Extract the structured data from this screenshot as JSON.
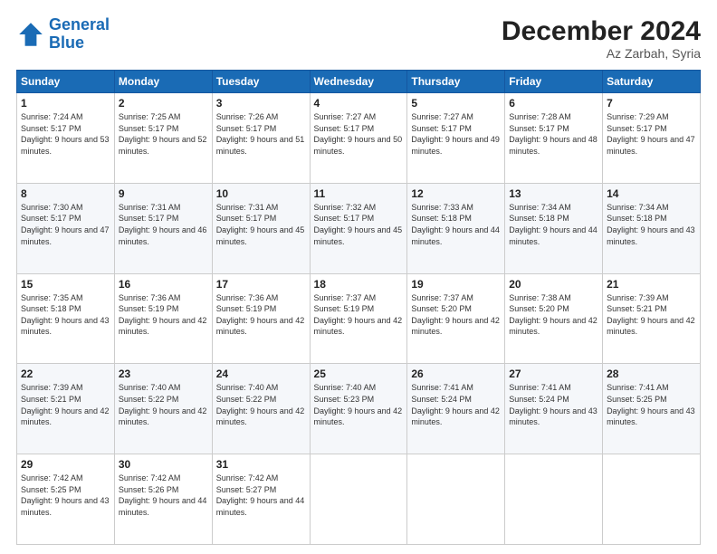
{
  "logo": {
    "line1": "General",
    "line2": "Blue"
  },
  "title": "December 2024",
  "subtitle": "Az Zarbah, Syria",
  "days_header": [
    "Sunday",
    "Monday",
    "Tuesday",
    "Wednesday",
    "Thursday",
    "Friday",
    "Saturday"
  ],
  "weeks": [
    [
      {
        "day": "1",
        "sunrise": "Sunrise: 7:24 AM",
        "sunset": "Sunset: 5:17 PM",
        "daylight": "Daylight: 9 hours and 53 minutes."
      },
      {
        "day": "2",
        "sunrise": "Sunrise: 7:25 AM",
        "sunset": "Sunset: 5:17 PM",
        "daylight": "Daylight: 9 hours and 52 minutes."
      },
      {
        "day": "3",
        "sunrise": "Sunrise: 7:26 AM",
        "sunset": "Sunset: 5:17 PM",
        "daylight": "Daylight: 9 hours and 51 minutes."
      },
      {
        "day": "4",
        "sunrise": "Sunrise: 7:27 AM",
        "sunset": "Sunset: 5:17 PM",
        "daylight": "Daylight: 9 hours and 50 minutes."
      },
      {
        "day": "5",
        "sunrise": "Sunrise: 7:27 AM",
        "sunset": "Sunset: 5:17 PM",
        "daylight": "Daylight: 9 hours and 49 minutes."
      },
      {
        "day": "6",
        "sunrise": "Sunrise: 7:28 AM",
        "sunset": "Sunset: 5:17 PM",
        "daylight": "Daylight: 9 hours and 48 minutes."
      },
      {
        "day": "7",
        "sunrise": "Sunrise: 7:29 AM",
        "sunset": "Sunset: 5:17 PM",
        "daylight": "Daylight: 9 hours and 47 minutes."
      }
    ],
    [
      {
        "day": "8",
        "sunrise": "Sunrise: 7:30 AM",
        "sunset": "Sunset: 5:17 PM",
        "daylight": "Daylight: 9 hours and 47 minutes."
      },
      {
        "day": "9",
        "sunrise": "Sunrise: 7:31 AM",
        "sunset": "Sunset: 5:17 PM",
        "daylight": "Daylight: 9 hours and 46 minutes."
      },
      {
        "day": "10",
        "sunrise": "Sunrise: 7:31 AM",
        "sunset": "Sunset: 5:17 PM",
        "daylight": "Daylight: 9 hours and 45 minutes."
      },
      {
        "day": "11",
        "sunrise": "Sunrise: 7:32 AM",
        "sunset": "Sunset: 5:17 PM",
        "daylight": "Daylight: 9 hours and 45 minutes."
      },
      {
        "day": "12",
        "sunrise": "Sunrise: 7:33 AM",
        "sunset": "Sunset: 5:18 PM",
        "daylight": "Daylight: 9 hours and 44 minutes."
      },
      {
        "day": "13",
        "sunrise": "Sunrise: 7:34 AM",
        "sunset": "Sunset: 5:18 PM",
        "daylight": "Daylight: 9 hours and 44 minutes."
      },
      {
        "day": "14",
        "sunrise": "Sunrise: 7:34 AM",
        "sunset": "Sunset: 5:18 PM",
        "daylight": "Daylight: 9 hours and 43 minutes."
      }
    ],
    [
      {
        "day": "15",
        "sunrise": "Sunrise: 7:35 AM",
        "sunset": "Sunset: 5:18 PM",
        "daylight": "Daylight: 9 hours and 43 minutes."
      },
      {
        "day": "16",
        "sunrise": "Sunrise: 7:36 AM",
        "sunset": "Sunset: 5:19 PM",
        "daylight": "Daylight: 9 hours and 42 minutes."
      },
      {
        "day": "17",
        "sunrise": "Sunrise: 7:36 AM",
        "sunset": "Sunset: 5:19 PM",
        "daylight": "Daylight: 9 hours and 42 minutes."
      },
      {
        "day": "18",
        "sunrise": "Sunrise: 7:37 AM",
        "sunset": "Sunset: 5:19 PM",
        "daylight": "Daylight: 9 hours and 42 minutes."
      },
      {
        "day": "19",
        "sunrise": "Sunrise: 7:37 AM",
        "sunset": "Sunset: 5:20 PM",
        "daylight": "Daylight: 9 hours and 42 minutes."
      },
      {
        "day": "20",
        "sunrise": "Sunrise: 7:38 AM",
        "sunset": "Sunset: 5:20 PM",
        "daylight": "Daylight: 9 hours and 42 minutes."
      },
      {
        "day": "21",
        "sunrise": "Sunrise: 7:39 AM",
        "sunset": "Sunset: 5:21 PM",
        "daylight": "Daylight: 9 hours and 42 minutes."
      }
    ],
    [
      {
        "day": "22",
        "sunrise": "Sunrise: 7:39 AM",
        "sunset": "Sunset: 5:21 PM",
        "daylight": "Daylight: 9 hours and 42 minutes."
      },
      {
        "day": "23",
        "sunrise": "Sunrise: 7:40 AM",
        "sunset": "Sunset: 5:22 PM",
        "daylight": "Daylight: 9 hours and 42 minutes."
      },
      {
        "day": "24",
        "sunrise": "Sunrise: 7:40 AM",
        "sunset": "Sunset: 5:22 PM",
        "daylight": "Daylight: 9 hours and 42 minutes."
      },
      {
        "day": "25",
        "sunrise": "Sunrise: 7:40 AM",
        "sunset": "Sunset: 5:23 PM",
        "daylight": "Daylight: 9 hours and 42 minutes."
      },
      {
        "day": "26",
        "sunrise": "Sunrise: 7:41 AM",
        "sunset": "Sunset: 5:24 PM",
        "daylight": "Daylight: 9 hours and 42 minutes."
      },
      {
        "day": "27",
        "sunrise": "Sunrise: 7:41 AM",
        "sunset": "Sunset: 5:24 PM",
        "daylight": "Daylight: 9 hours and 43 minutes."
      },
      {
        "day": "28",
        "sunrise": "Sunrise: 7:41 AM",
        "sunset": "Sunset: 5:25 PM",
        "daylight": "Daylight: 9 hours and 43 minutes."
      }
    ],
    [
      {
        "day": "29",
        "sunrise": "Sunrise: 7:42 AM",
        "sunset": "Sunset: 5:25 PM",
        "daylight": "Daylight: 9 hours and 43 minutes."
      },
      {
        "day": "30",
        "sunrise": "Sunrise: 7:42 AM",
        "sunset": "Sunset: 5:26 PM",
        "daylight": "Daylight: 9 hours and 44 minutes."
      },
      {
        "day": "31",
        "sunrise": "Sunrise: 7:42 AM",
        "sunset": "Sunset: 5:27 PM",
        "daylight": "Daylight: 9 hours and 44 minutes."
      },
      null,
      null,
      null,
      null
    ]
  ]
}
